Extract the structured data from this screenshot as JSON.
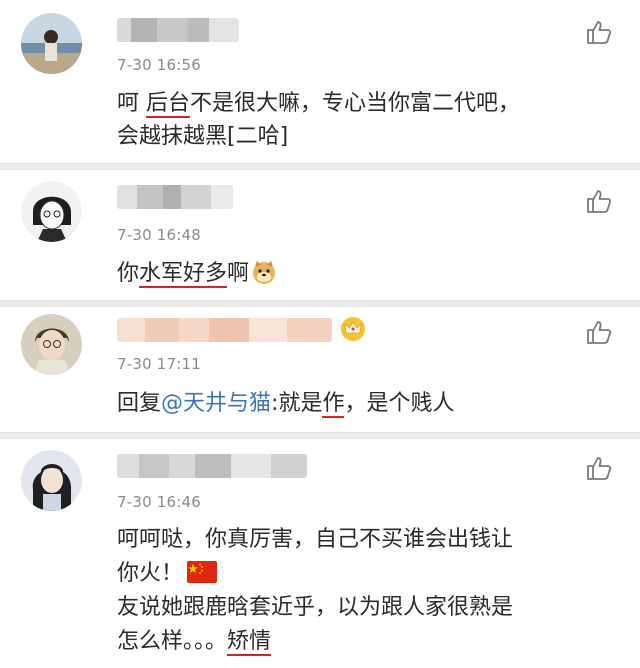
{
  "comments": [
    {
      "time": "7-30 16:56",
      "lines": [
        {
          "pre": "呵  ",
          "u": "后台",
          "post": "不是很大嘛，专心当你富二代吧，"
        },
        {
          "pre": "会越抹越黑[二哈]",
          "u": "",
          "post": ""
        }
      ]
    },
    {
      "time": "7-30 16:48",
      "lines": [
        {
          "pre": "你",
          "u": "水军好多",
          "post": "啊"
        }
      ]
    },
    {
      "time": "7-30 17:11",
      "reply_prefix": "回复",
      "mention": "@天井与猫",
      "after_mention": ":就是",
      "u": "作",
      "post": "，是个贱人"
    },
    {
      "time": "7-30 16:46",
      "lines": [
        {
          "pre": "呵呵哒，你真厉害，自己不买谁会出钱让",
          "u": "",
          "post": ""
        },
        {
          "pre": "你火！",
          "u": "",
          "post": ""
        },
        {
          "pre": "友说她跟鹿晗套近乎，以为跟人家很熟是",
          "u": "",
          "post": ""
        },
        {
          "pre": "怎么样。。。",
          "u": "矫情",
          "post": ""
        }
      ]
    }
  ],
  "icons": {
    "like": "thumbs-up-icon",
    "emoji_dog": "doge-emoji-icon",
    "emoji_flag": "china-flag-icon",
    "vip": "crown-icon"
  },
  "colors": {
    "underline": "#d8222a",
    "mention": "#3b77b8",
    "time": "#8a8a8a",
    "divider": "#ececec"
  }
}
